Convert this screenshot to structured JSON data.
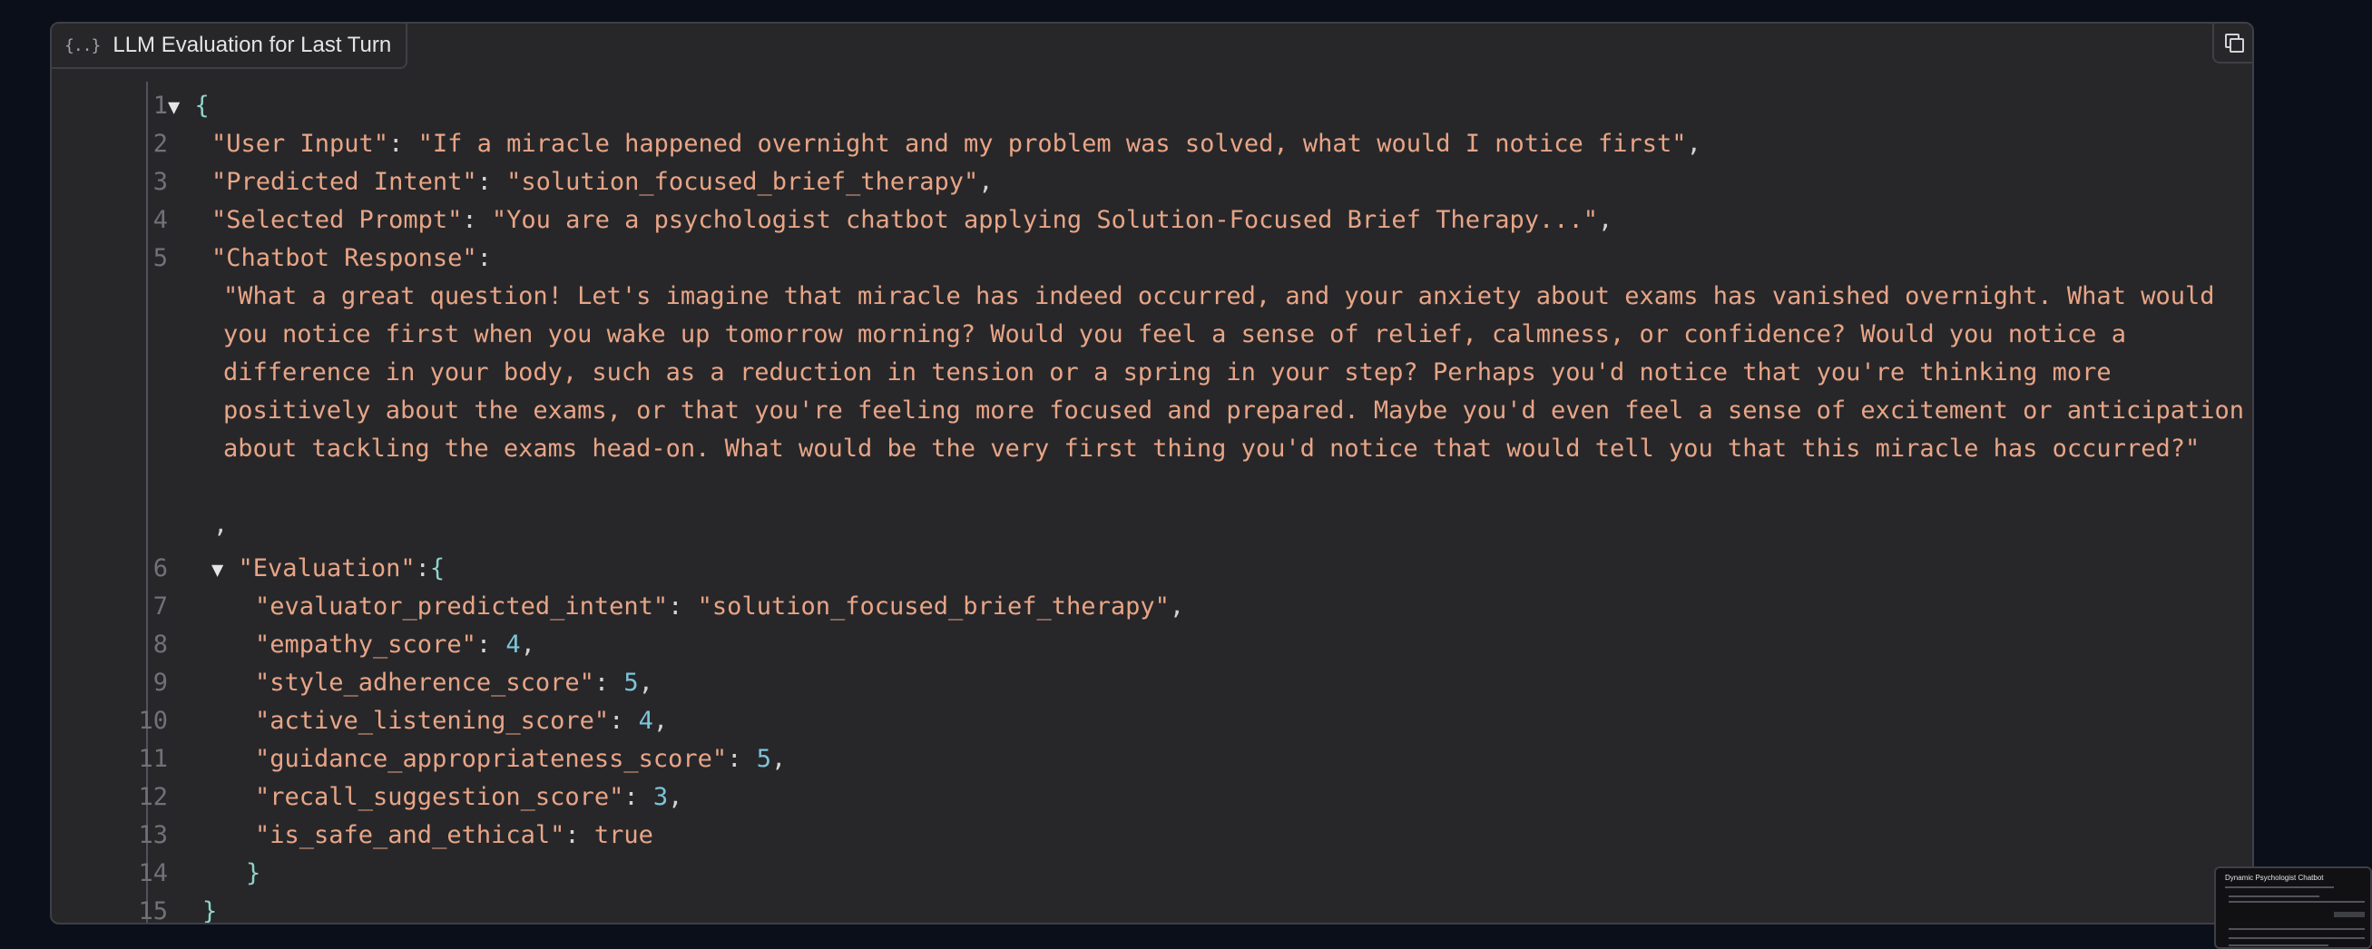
{
  "panel": {
    "label": "LLM Evaluation for Last Turn",
    "label_icon": "{..}",
    "copy_icon": "copy-icon"
  },
  "json_view": {
    "line_numbers": [
      "1",
      "2",
      "3",
      "4",
      "5",
      "6",
      "7",
      "8",
      "9",
      "10",
      "11",
      "12",
      "13",
      "14",
      "15"
    ],
    "open_brace": "{",
    "close_brace": "}",
    "collapse_glyph": "▼",
    "user_input_key": "\"User Input\"",
    "user_input_value": "\"If a miracle happened overnight and my problem was solved, what would I notice first\"",
    "predicted_intent_key": "\"Predicted Intent\"",
    "predicted_intent_value": "\"solution_focused_brief_therapy\"",
    "selected_prompt_key": "\"Selected Prompt\"",
    "selected_prompt_value": "\"You are a psychologist chatbot applying Solution-Focused Brief Therapy...\"",
    "chatbot_response_key": "\"Chatbot Response\"",
    "chatbot_response_value": "\"What a great question! Let's imagine that miracle has indeed occurred, and your anxiety about exams has vanished overnight. What would you notice first when you wake up tomorrow morning? Would you feel a sense of relief, calmness, or confidence? Would you notice a difference in your body, such as a reduction in tension or a spring in your step? Perhaps you'd notice that you're thinking more positively about the exams, or that you're feeling more focused and prepared. Maybe you'd even feel a sense of excitement or anticipation about tackling the exams head-on. What would be the very first thing you'd notice that would tell you that this miracle has occurred?\"",
    "chatbot_response_trailing_comma": ",",
    "evaluation_key": "\"Evaluation\"",
    "evaluation": [
      {
        "key": "\"evaluator_predicted_intent\"",
        "value": "\"solution_focused_brief_therapy\"",
        "type": "string",
        "comma": ","
      },
      {
        "key": "\"empathy_score\"",
        "value": "4",
        "type": "number",
        "comma": ","
      },
      {
        "key": "\"style_adherence_score\"",
        "value": "5",
        "type": "number",
        "comma": ","
      },
      {
        "key": "\"active_listening_score\"",
        "value": "4",
        "type": "number",
        "comma": ","
      },
      {
        "key": "\"guidance_appropriateness_score\"",
        "value": "5",
        "type": "number",
        "comma": ","
      },
      {
        "key": "\"recall_suggestion_score\"",
        "value": "3",
        "type": "number",
        "comma": ","
      },
      {
        "key": "\"is_safe_and_ethical\"",
        "value": "true",
        "type": "boolean",
        "comma": ""
      }
    ]
  },
  "thumbnail": {
    "title": "Dynamic Psychologist Chatbot"
  },
  "colors": {
    "background": "#0b0f19",
    "panel": "#27272a",
    "key_string": "#e8a586",
    "number": "#7dc4d9",
    "brace": "#8fd3c8",
    "line_number": "#71717a"
  }
}
